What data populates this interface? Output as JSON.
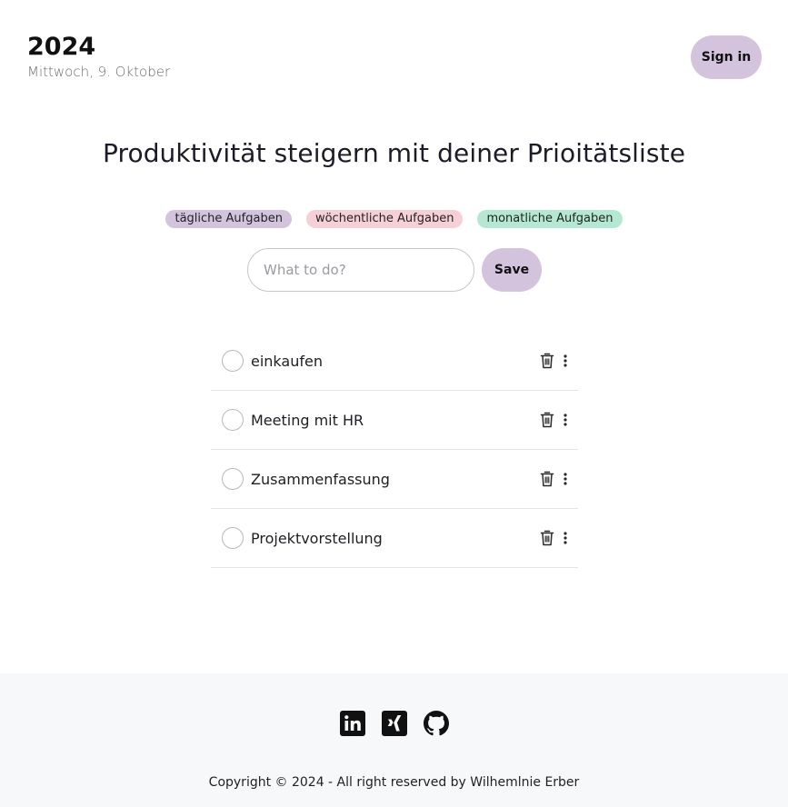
{
  "header": {
    "year": "2024",
    "date": "Mittwoch, 9. Oktober",
    "signin_label": "Sign in"
  },
  "main": {
    "title": "Produktivität steigern mit deiner Prioitätsliste",
    "tags": [
      {
        "label": "tägliche Aufgaben",
        "color": "#d3c3dd"
      },
      {
        "label": "wöchentliche Aufgaben",
        "color": "#f6d0d6"
      },
      {
        "label": "monatliche Aufgaben",
        "color": "#b5e8d3"
      }
    ],
    "input": {
      "placeholder": "What to do?",
      "value": ""
    },
    "save_label": "Save",
    "todos": [
      {
        "text": "einkaufen",
        "done": false
      },
      {
        "text": "Meeting mit HR",
        "done": false
      },
      {
        "text": "Zusammenfassung",
        "done": false
      },
      {
        "text": "Projektvorstellung",
        "done": false
      }
    ],
    "item_icons": [
      "trash-icon",
      "more-vertical-icon"
    ]
  },
  "footer": {
    "social_icons": [
      "linkedin-icon",
      "xing-icon",
      "github-icon"
    ],
    "copyright": "Copyright © 2024 - All right reserved by Wilhemlnie Erber"
  },
  "colors": {
    "accent": "#d3c3dd",
    "footer_bg": "#f7f8fa"
  }
}
